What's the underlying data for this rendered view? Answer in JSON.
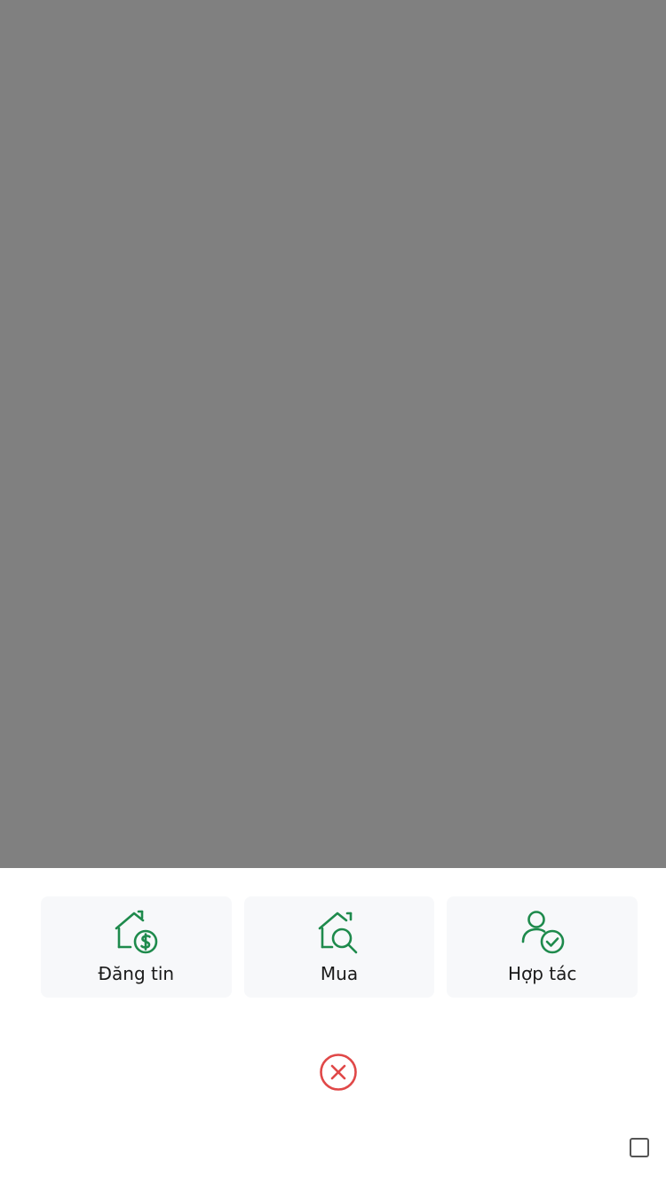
{
  "colors": {
    "overlay": "#808080",
    "icon_green": "#1e8a4c",
    "close_red": "#e04848",
    "card_bg": "#f7f8fa"
  },
  "actions": [
    {
      "label": "Đăng tin",
      "icon": "house-dollar-icon"
    },
    {
      "label": "Mua",
      "icon": "house-search-icon"
    },
    {
      "label": "Hợp tác",
      "icon": "user-check-icon"
    }
  ],
  "close": {
    "icon": "close-circle-icon"
  },
  "corner_control": {
    "icon": "square-checkbox-icon"
  }
}
